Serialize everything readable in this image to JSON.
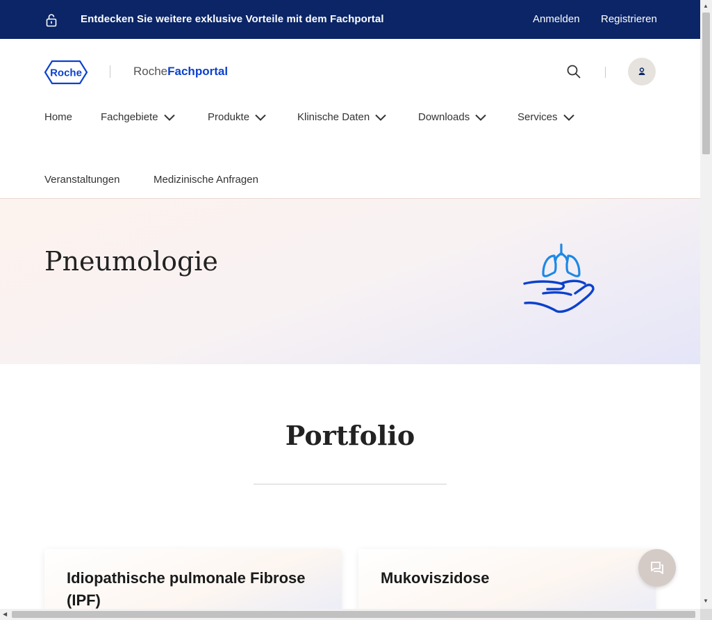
{
  "topbar": {
    "promo_text": "Entdecken Sie weitere exklusive Vorteile mit dem Fachportal",
    "login": "Anmelden",
    "register": "Registrieren",
    "icon": "lock-open-icon"
  },
  "header": {
    "logo_text": "Roche",
    "brand_light": "Roche",
    "brand_bold": "Fachportal",
    "search_icon": "search-icon",
    "user_icon": "user-icon"
  },
  "nav": {
    "items": [
      {
        "label": "Home"
      },
      {
        "label": "Fachgebiete"
      },
      {
        "label": "Produkte"
      },
      {
        "label": "Klinische Daten"
      },
      {
        "label": "Downloads"
      },
      {
        "label": "Services"
      },
      {
        "label": "Veranstaltungen"
      },
      {
        "label": "Medizinische Anfragen"
      }
    ]
  },
  "hero": {
    "title": "Pneumologie",
    "illustration": "lungs-hand-icon"
  },
  "portfolio": {
    "title": "Portfolio",
    "cards": [
      {
        "title": "Idiopathische pulmonale Fibrose (IPF)"
      },
      {
        "title": "Mukoviszidose"
      }
    ]
  },
  "chat": {
    "icon": "chat-icon"
  },
  "colors": {
    "topbar_bg": "#0b2566",
    "brand_blue": "#0b41cd",
    "icon_blue": "#1e88e5"
  }
}
